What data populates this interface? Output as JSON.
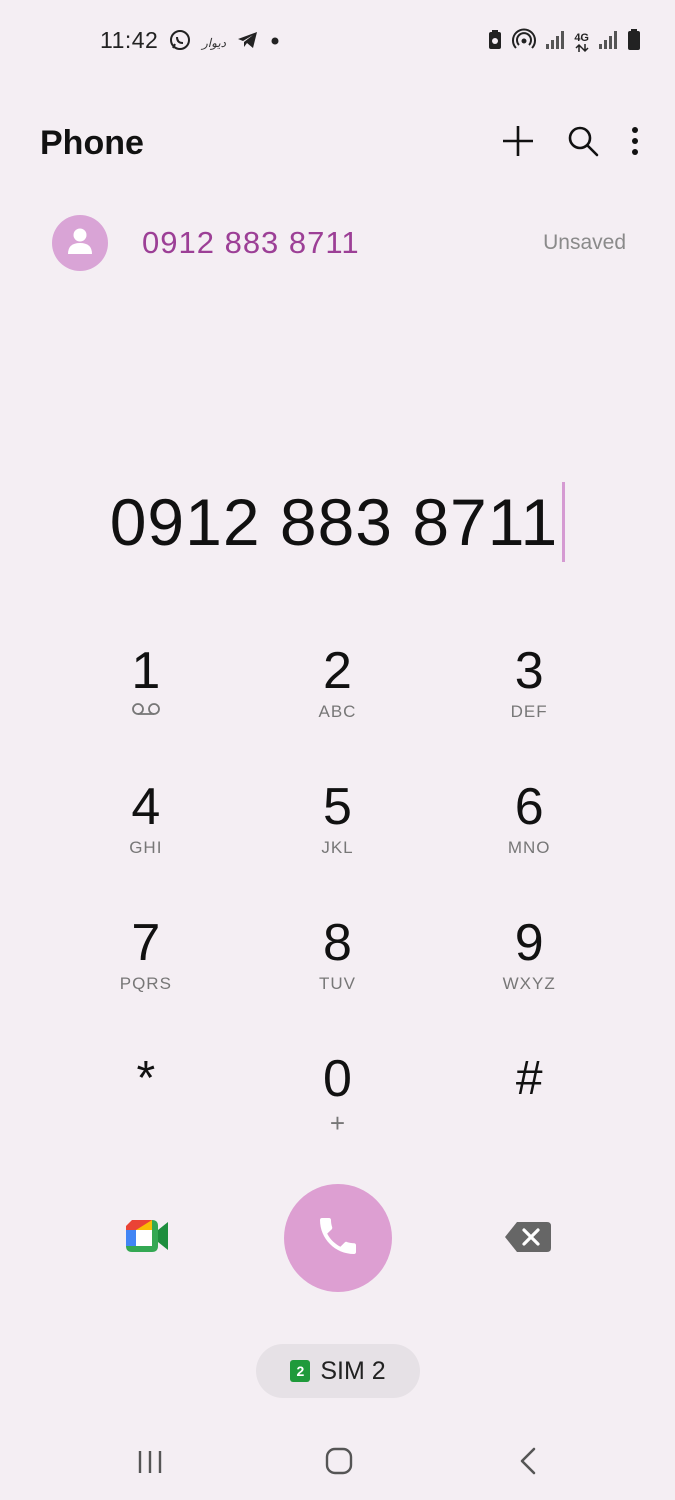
{
  "status_bar": {
    "time": "11:42",
    "left_icons": [
      "whatsapp-icon",
      "app-text-icon",
      "telegram-icon",
      "dot-icon"
    ],
    "app_text_icon_label": "دیوار",
    "right_icons": [
      "battery-saver-icon",
      "hotspot-icon",
      "signal-icon",
      "network-4g-icon",
      "signal-icon",
      "battery-icon"
    ],
    "network_label": "4G"
  },
  "header": {
    "title": "Phone",
    "actions": [
      "add-icon",
      "search-icon",
      "more-options-icon"
    ]
  },
  "suggestion": {
    "number": "0912 883 8711",
    "status": "Unsaved"
  },
  "dialed_number": "0912 883 8711",
  "keypad": [
    {
      "digit": "1",
      "letters": "",
      "sub_icon": "voicemail-icon"
    },
    {
      "digit": "2",
      "letters": "ABC"
    },
    {
      "digit": "3",
      "letters": "DEF"
    },
    {
      "digit": "4",
      "letters": "GHI"
    },
    {
      "digit": "5",
      "letters": "JKL"
    },
    {
      "digit": "6",
      "letters": "MNO"
    },
    {
      "digit": "7",
      "letters": "PQRS"
    },
    {
      "digit": "8",
      "letters": "TUV"
    },
    {
      "digit": "9",
      "letters": "WXYZ"
    },
    {
      "digit": "*",
      "letters": ""
    },
    {
      "digit": "0",
      "letters": "+"
    },
    {
      "digit": "#",
      "letters": ""
    }
  ],
  "bottom_actions": {
    "left": "video-call-icon",
    "center": "call-icon",
    "right": "backspace-icon"
  },
  "sim": {
    "number": "2",
    "label": "SIM 2"
  },
  "nav_bar": [
    "recents-icon",
    "home-icon",
    "back-icon"
  ],
  "colors": {
    "background": "#f4eef3",
    "accent": "#dd9fd2",
    "suggestion_text": "#9c3f96",
    "sim_badge": "#1f9a3b"
  }
}
